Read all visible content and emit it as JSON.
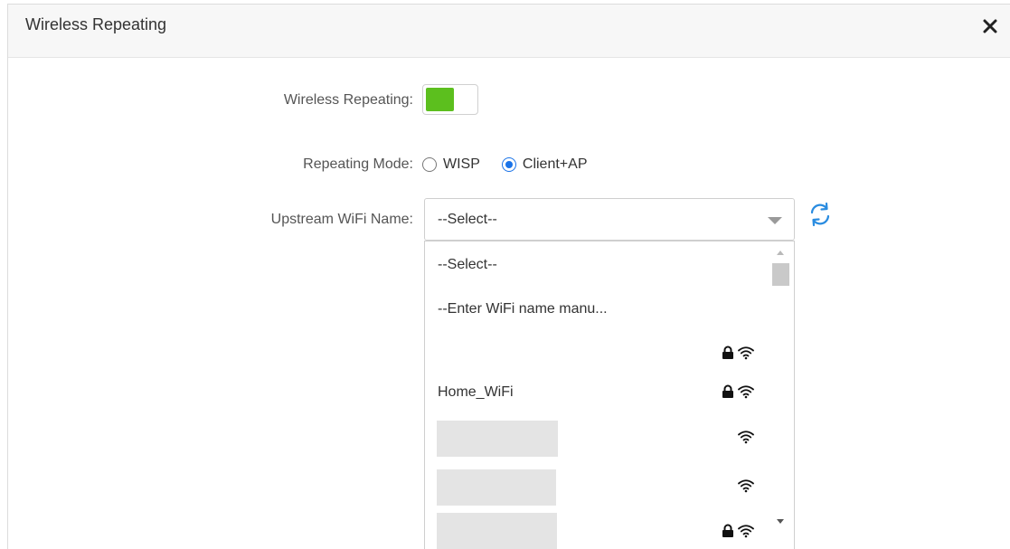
{
  "dialog": {
    "title": "Wireless Repeating",
    "close_icon": "close-icon"
  },
  "form": {
    "wireless_repeating": {
      "label": "Wireless Repeating:",
      "enabled": true,
      "on_color": "#5cbf1e"
    },
    "repeating_mode": {
      "label": "Repeating Mode:",
      "options": [
        {
          "label": "WISP",
          "checked": false
        },
        {
          "label": "Client+AP",
          "checked": true
        }
      ],
      "accent_color": "#1a73e8"
    },
    "upstream_wifi": {
      "label": "Upstream WiFi Name:",
      "selected": "--Select--",
      "refresh_icon": "refresh-icon",
      "options": [
        {
          "label": "--Select--",
          "locked": false,
          "wifi": false,
          "redacted": false
        },
        {
          "label": "--Enter WiFi name manu...",
          "locked": false,
          "wifi": false,
          "redacted": false
        },
        {
          "label": "",
          "locked": true,
          "wifi": true,
          "redacted": false
        },
        {
          "label": "Home_WiFi",
          "locked": true,
          "wifi": true,
          "redacted": false
        },
        {
          "label": "",
          "locked": false,
          "wifi": true,
          "redacted": true
        },
        {
          "label": "",
          "locked": false,
          "wifi": true,
          "redacted": true
        },
        {
          "label": "",
          "locked": true,
          "wifi": true,
          "redacted": true
        }
      ]
    }
  }
}
